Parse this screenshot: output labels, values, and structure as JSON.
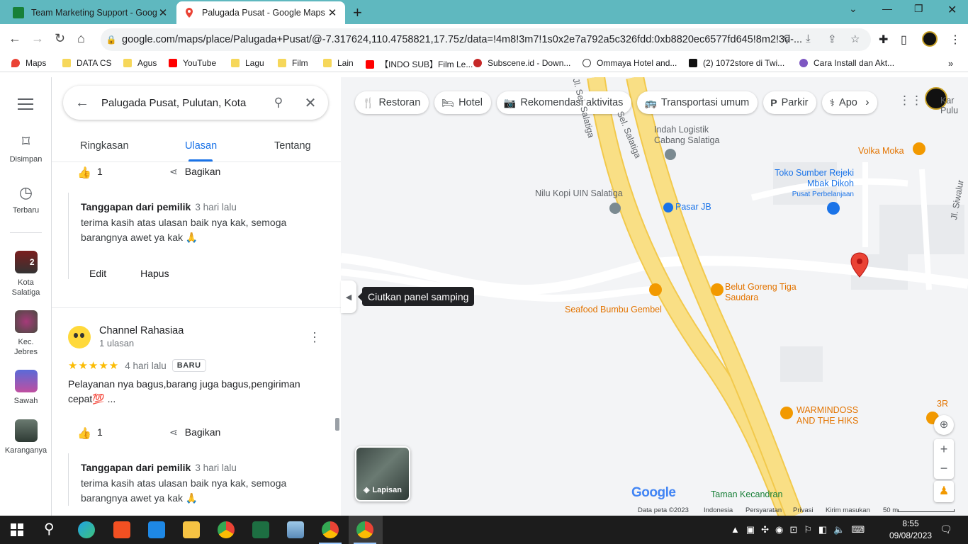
{
  "browser": {
    "tabs": [
      {
        "title": "Team Marketing Support - Goog",
        "active": false
      },
      {
        "title": "Palugada Pusat - Google Maps",
        "active": true
      }
    ],
    "url": "google.com/maps/place/Palugada+Pusat/@-7.317624,110.4758821,17.75z/data=!4m8!3m7!1s0x2e7a792a5c326fdd:0xb8820ec6577fd645!8m2!3d-...",
    "bookmarks": [
      "Maps",
      "DATA CS",
      "Agus",
      "YouTube",
      "Lagu",
      "Film",
      "Lain",
      "【INDO SUB】Film Le...",
      "Subscene.id - Down...",
      "Ommaya Hotel and...",
      "(2) 1072store di Twi...",
      "Cara Install dan Akt..."
    ]
  },
  "rail": {
    "saved": "Disimpan",
    "recent": "Terbaru",
    "places": [
      {
        "label": "Kota Salatiga",
        "badge": "2"
      },
      {
        "label": "Kec. Jebres"
      },
      {
        "label": "Sawah"
      },
      {
        "label": "Karanganya"
      }
    ]
  },
  "panel": {
    "search_query": "Palugada Pusat, Pulutan, Kota",
    "tabs": [
      "Ringkasan",
      "Ulasan",
      "Tentang"
    ],
    "active_tab": "Ulasan",
    "share_label": "Bagikan",
    "review1": {
      "likes": "1",
      "owner_reply_label": "Tanggapan dari pemilik",
      "owner_reply_time": "3 hari lalu",
      "owner_reply_text": "terima kasih atas ulasan baik nya kak, semoga barangnya awet ya kak 🙏",
      "edit_label": "Edit",
      "delete_label": "Hapus"
    },
    "review2": {
      "reviewer_name": "Channel Rahasiaa",
      "reviewer_sub": "1 ulasan",
      "rating": 5,
      "time": "4 hari lalu",
      "badge": "BARU",
      "text": "Pelayanan nya bagus,barang juga bagus,pengiriman cepat💯 ...",
      "likes": "1",
      "owner_reply_label": "Tanggapan dari pemilik",
      "owner_reply_time": "3 hari lalu",
      "owner_reply_text": "terima kasih atas ulasan baik nya kak, semoga barangnya awet ya kak 🙏"
    }
  },
  "tooltip": "Ciutkan panel samping",
  "map": {
    "chips": [
      "Restoran",
      "Hotel",
      "Rekomendasi aktivitas",
      "Transportasi umum",
      "Parkir",
      "Apo"
    ],
    "roads": [
      "Jl. Sei. Salatiga",
      "Sel. Salatiga",
      "Jl. Siwalur"
    ],
    "pois": {
      "indah_logistik": "Indah Logistik Cabang Salatiga",
      "volka_moka": "Volka Moka",
      "toko_sumber": "Toko Sumber Rejeki Mbak Dikoh",
      "toko_sumber_sub": "Pusat Perbelanjaan",
      "nilu_kopi": "Nilu Kopi UIN Salatiga",
      "pasar_jb": "Pasar JB",
      "belut": "Belut Goreng Tiga Saudara",
      "seafood": "Seafood Bumbu Gembel",
      "warmindoss": "WARMINDOSS AND THE HIKS",
      "taman": "Taman Kecandran",
      "pulu": "Pulu",
      "kar": "Kar",
      "threer": "3R"
    },
    "layers_label": "Lapisan",
    "google_logo": "Google",
    "footer": [
      "Data peta ©2023",
      "Indonesia",
      "Persyaratan",
      "Privasi",
      "Kirim masukan",
      "50 m"
    ]
  },
  "taskbar": {
    "time": "8:55",
    "date": "09/08/2023"
  },
  "colors": {
    "accent": "#1a73e8",
    "tabstrip": "#5fb8bf",
    "road": "#f7d56a",
    "pin": "#ea4335"
  }
}
